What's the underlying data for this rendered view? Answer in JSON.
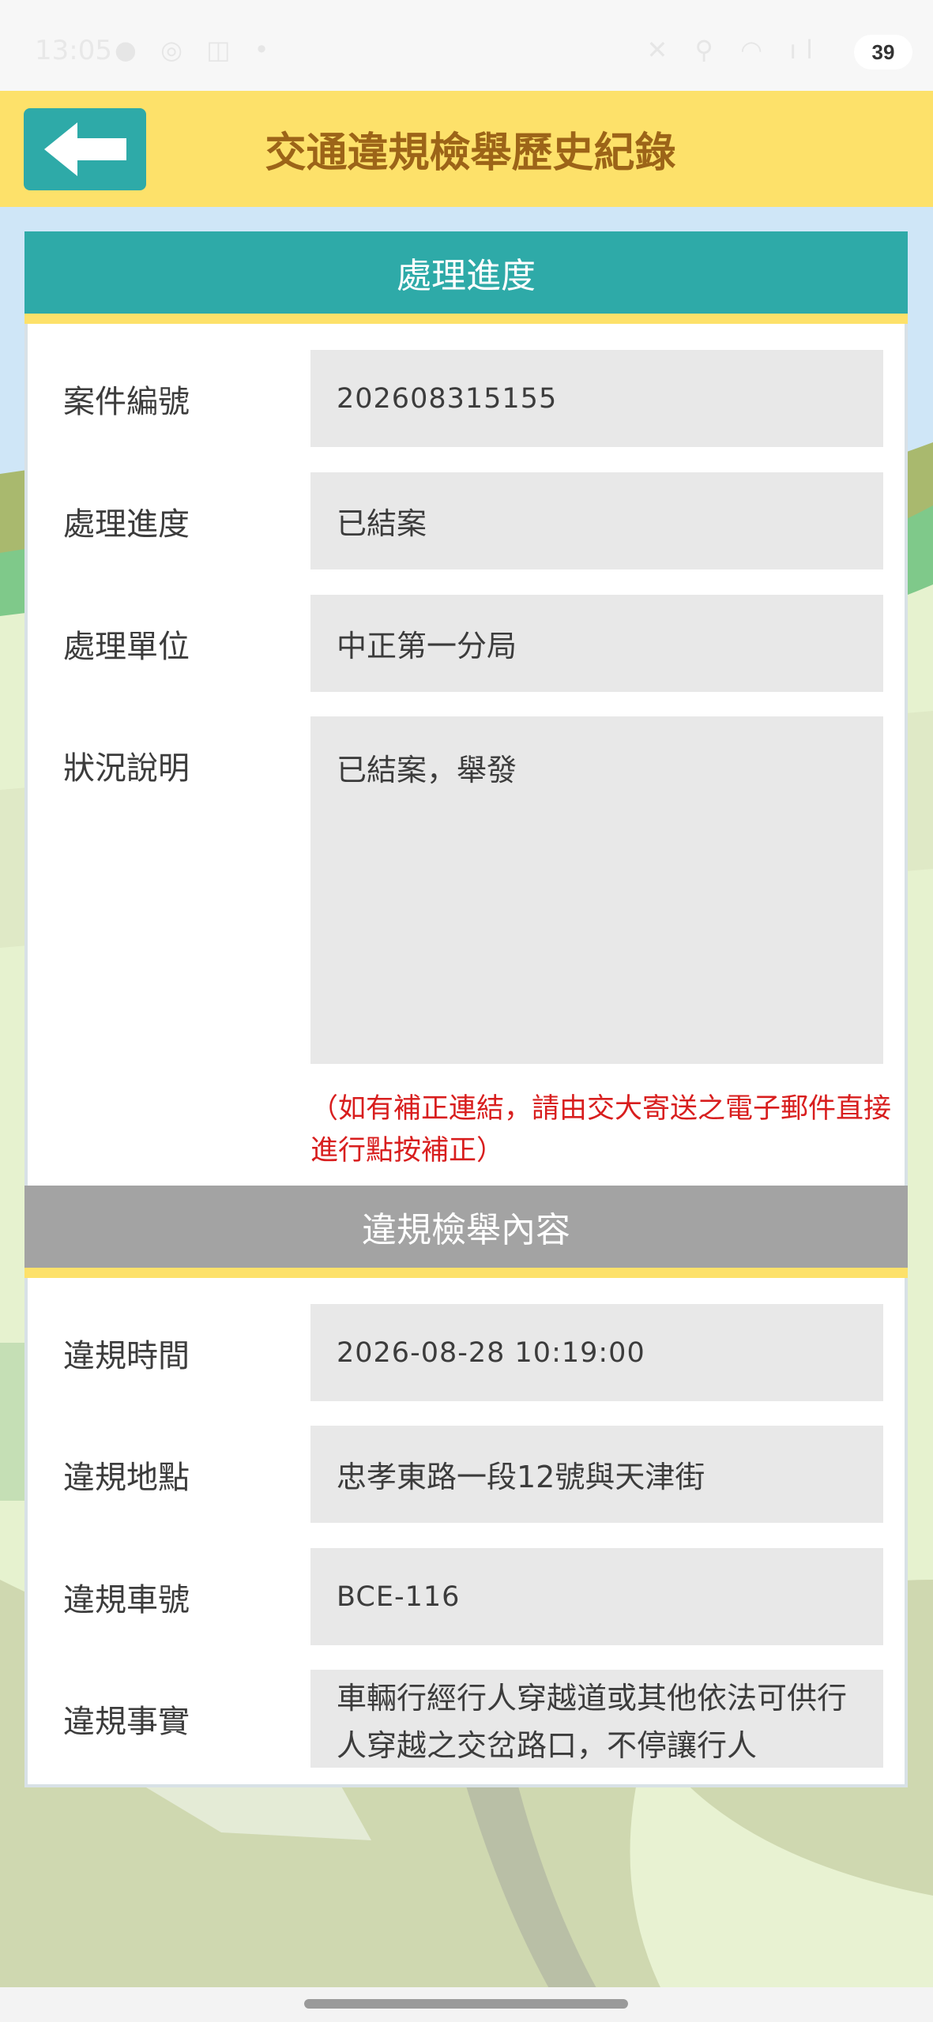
{
  "status_bar": {
    "time": "13:05",
    "left_icons": "● ◎ ◫ •",
    "right_icons": "✕ ⚲ ◠ ıl",
    "battery": "39"
  },
  "header": {
    "title": "交通違規檢舉歷史紀錄",
    "back_icon": "arrow-left-icon"
  },
  "progress_section": {
    "title": "處理進度",
    "fields": [
      {
        "label": "案件編號",
        "value": "202608315155"
      },
      {
        "label": "處理進度",
        "value": "已結案"
      },
      {
        "label": "處理單位",
        "value": "中正第一分局"
      },
      {
        "label": "狀況說明",
        "value": "已結案，舉發"
      }
    ],
    "note": "（如有補正連結，請由交大寄送之電子郵件直接進行點按補正）"
  },
  "violation_section": {
    "title": "違規檢舉內容",
    "fields": [
      {
        "label": "違規時間",
        "value": "2026-08-28 10:19:00"
      },
      {
        "label": "違規地點",
        "value": "忠孝東路一段12號與天津街"
      },
      {
        "label": "違規車號",
        "value": "BCE-116"
      },
      {
        "label": "違規事實",
        "value": "車輛行經行人穿越道或其他依法可供行人穿越之交岔路口，不停讓行人"
      }
    ]
  },
  "colors": {
    "header_bg": "#fde16a",
    "accent_teal": "#2eaaa8",
    "title_brown": "#9c6418",
    "section_gray": "#a3a3a3",
    "field_bg": "#e8e8e8",
    "note_red": "#d81e1e"
  }
}
